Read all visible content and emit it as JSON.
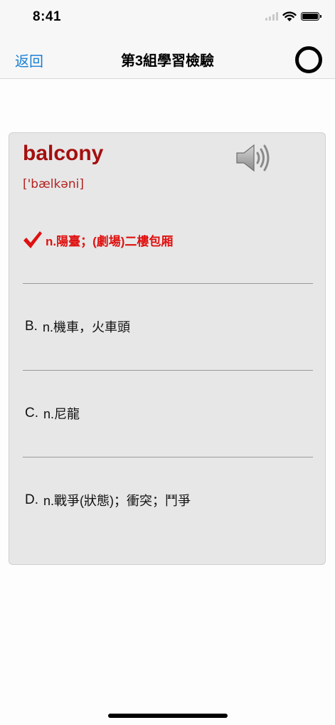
{
  "status_bar": {
    "time": "8:41",
    "icons": [
      "signal-icon",
      "wifi-icon",
      "battery-icon"
    ]
  },
  "nav": {
    "back_label": "返回",
    "title": "第3組學習檢驗",
    "right_icon": "circle-icon"
  },
  "quiz": {
    "word": "balcony",
    "phonetic": "['bælkəni]",
    "speaker_icon": "speaker-icon",
    "options": [
      {
        "letter": "",
        "text": "n.陽臺；(劇場)二樓包厢",
        "correct": true,
        "icon": "checkmark-icon"
      },
      {
        "letter": "B.",
        "text": "n.機車，火車頭",
        "correct": false
      },
      {
        "letter": "C.",
        "text": "n.尼龍",
        "correct": false
      },
      {
        "letter": "D.",
        "text": "n.戰爭(狀態)；衝突；鬥爭",
        "correct": false
      }
    ]
  },
  "colors": {
    "accent_blue": "#1a7fd4",
    "word_red": "#a50f0f",
    "correct_red": "#e01010",
    "card_bg": "#e7e7e7"
  }
}
